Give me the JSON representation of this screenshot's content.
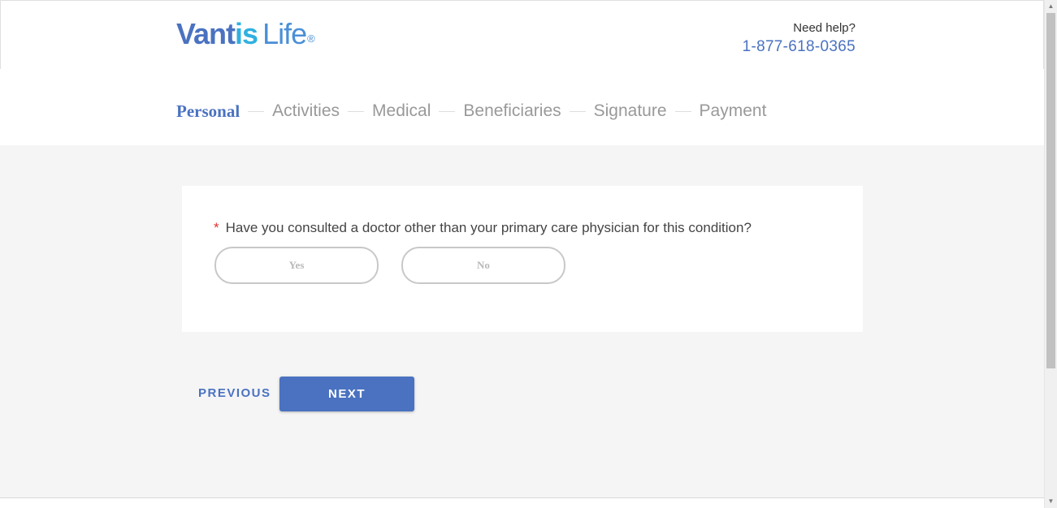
{
  "header": {
    "logo": {
      "brand_part1": "Vant",
      "brand_part2": "is",
      "brand_part3": "Life",
      "registered": "®"
    },
    "help_label": "Need help?",
    "help_phone": "1-877-618-0365"
  },
  "steps": [
    {
      "label": "Personal",
      "active": true
    },
    {
      "label": "Activities",
      "active": false
    },
    {
      "label": "Medical",
      "active": false
    },
    {
      "label": "Beneficiaries",
      "active": false
    },
    {
      "label": "Signature",
      "active": false
    },
    {
      "label": "Payment",
      "active": false
    }
  ],
  "question": {
    "required_marker": "*",
    "text": "Have you consulted a doctor other than your primary care physician for this condition?",
    "options": [
      "Yes",
      "No"
    ]
  },
  "navigation": {
    "previous_label": "PREVIOUS",
    "next_label": "NEXT"
  },
  "scrollbar": {
    "up_arrow": "▲",
    "down_arrow": "▼"
  },
  "colors": {
    "brand_blue": "#4a72c0",
    "brand_cyan": "#2fb0e0",
    "required_red": "#e03030",
    "muted_gray": "#999999",
    "background": "#f5f5f5"
  }
}
